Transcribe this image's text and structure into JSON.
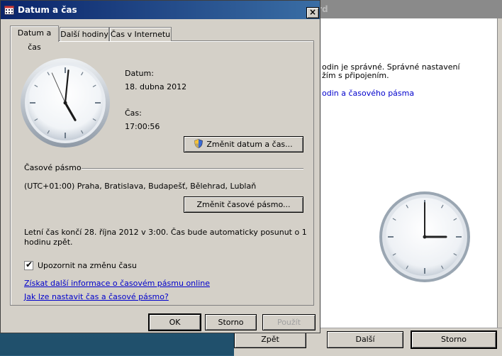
{
  "background_window": {
    "title_fragment": "ard",
    "body_line1": "odin je správné. Správné nastavení",
    "body_line2": "žím s připojením.",
    "link": "odin a časového pásma",
    "buttons": {
      "back": "Zpět",
      "next": "Další",
      "cancel": "Storno"
    }
  },
  "dialog": {
    "title": "Datum a čas",
    "close_label": "×",
    "tabs": [
      "Datum a čas",
      "Další hodiny",
      "Čas v Internetu"
    ],
    "date": {
      "label": "Datum:",
      "value": "18. dubna 2012"
    },
    "time": {
      "label": "Čas:",
      "value": "17:00:56"
    },
    "change_datetime_button": "Změnit datum a čas...",
    "timezone": {
      "heading": "Časové pásmo",
      "value": "(UTC+01:00) Praha, Bratislava, Budapešť, Bělehrad, Lublaň",
      "change_button": "Změnit časové pásmo..."
    },
    "dst": {
      "line1": "Letní čas končí 28. října 2012 v 3:00. Čas bude automaticky posunut o 1",
      "line2": "hodinu zpět."
    },
    "notify": {
      "label": "Upozornit na změnu času",
      "checked": true,
      "mark": "✔"
    },
    "links": {
      "tz_info": "Získat další informace o časovém pásmu online",
      "howto": "Jak lze nastavit čas a časové pásmo?"
    },
    "buttons": {
      "ok": "OK",
      "cancel": "Storno",
      "apply": "Použít"
    }
  },
  "clocks": {
    "main": {
      "hours": 17,
      "minutes": 0,
      "seconds": 56
    },
    "background": {
      "hours": 3,
      "minutes": 0,
      "seconds": 0
    }
  },
  "colors": {
    "titlebar_start": "#0a246a",
    "titlebar_end": "#3a6ea5",
    "link": "#0000cc",
    "face": "#d4d0c8"
  }
}
